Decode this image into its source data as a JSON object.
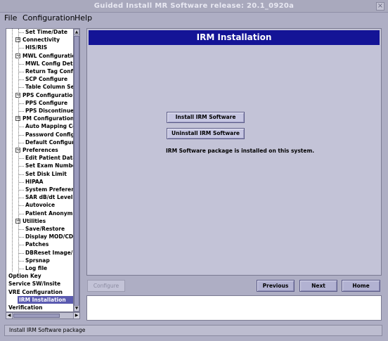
{
  "window": {
    "title": "Guided Install  MR Software release: 20.1_0920a",
    "close_glyph": "×"
  },
  "menubar": {
    "file": "File",
    "configuration": "Configuration",
    "help": "Help"
  },
  "tree": {
    "items": [
      {
        "label": "Set Time/Date",
        "level": 2
      },
      {
        "label": "Connectivity",
        "level": 1,
        "toggle": "−"
      },
      {
        "label": "HIS/RIS",
        "level": 2
      },
      {
        "label": "MWL Configuration",
        "level": 1,
        "toggle": "−"
      },
      {
        "label": "MWL Config Details",
        "level": 2
      },
      {
        "label": "Return Tag Configure",
        "level": 2
      },
      {
        "label": "SCP Configure",
        "level": 2
      },
      {
        "label": "Table Column Selection",
        "level": 2
      },
      {
        "label": "PPS Configuration",
        "level": 1,
        "toggle": "−"
      },
      {
        "label": "PPS Configure",
        "level": 2
      },
      {
        "label": "PPS Discontinue Reason",
        "level": 2
      },
      {
        "label": "PM Configuration",
        "level": 1,
        "toggle": "−"
      },
      {
        "label": "Auto Mapping Config",
        "level": 2
      },
      {
        "label": "Password Configure",
        "level": 2
      },
      {
        "label": "Default Configuration",
        "level": 2
      },
      {
        "label": "Preferences",
        "level": 1,
        "toggle": "−"
      },
      {
        "label": "Edit Patient Data",
        "level": 2
      },
      {
        "label": "Set Exam Number",
        "level": 2
      },
      {
        "label": "Set Disk Limit",
        "level": 2
      },
      {
        "label": "HIPAA",
        "level": 2
      },
      {
        "label": "System Preferences",
        "level": 2
      },
      {
        "label": "SAR dB/dt Level",
        "level": 2
      },
      {
        "label": "Autovoice",
        "level": 2
      },
      {
        "label": "Patient Anonymization",
        "level": 2
      },
      {
        "label": "Utilities",
        "level": 1,
        "toggle": "−"
      },
      {
        "label": "Save/Restore",
        "level": 2
      },
      {
        "label": "Display MOD/CD-ROM",
        "level": 2
      },
      {
        "label": "Patches",
        "level": 2
      },
      {
        "label": "DBReset Image/Error",
        "level": 2
      },
      {
        "label": "Sprsnap",
        "level": 2
      },
      {
        "label": "Log file",
        "level": 2
      },
      {
        "label": "Option Key",
        "level": 0
      },
      {
        "label": "Service SW/Insite",
        "level": 0
      },
      {
        "label": "VRE Configuration",
        "level": 0
      },
      {
        "label": "IRM Installation",
        "level": 0,
        "selected": true
      },
      {
        "label": "Verification",
        "level": 0
      }
    ]
  },
  "content": {
    "banner": "IRM Installation",
    "install_button": "Install IRM Software",
    "uninstall_button": "Uninstall IRM Software",
    "status_message": "IRM Software package is installed on this system."
  },
  "nav": {
    "configure": "Configure",
    "previous": "Previous",
    "next": "Next",
    "home": "Home"
  },
  "statusbar": {
    "text": "Install IRM Software package"
  },
  "scroll_glyphs": {
    "up": "▲",
    "down": "▼",
    "left": "◀",
    "right": "▶"
  },
  "colors": {
    "banner": "#141496",
    "selection": "#5a5ab0",
    "background": "#aeaec4"
  }
}
